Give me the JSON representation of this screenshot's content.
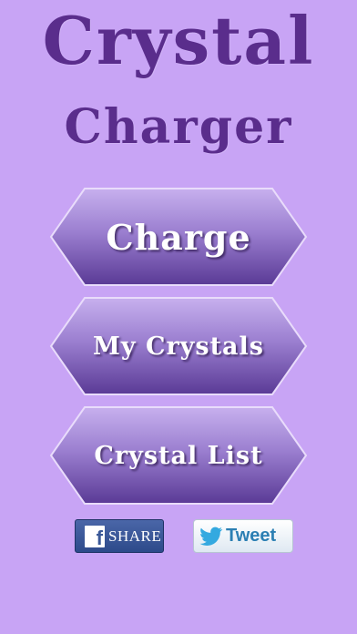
{
  "title": {
    "line1": "Crystal",
    "line2": "Charger"
  },
  "menu": {
    "charge_label": "Charge",
    "my_crystals_label": "My Crystals",
    "crystal_list_label": "Crystal List"
  },
  "social": {
    "share_label": "SHARE",
    "facebook_glyph": "f",
    "tweet_label": "Tweet"
  },
  "icons": {
    "facebook": "facebook-icon",
    "twitter": "twitter-bird-icon"
  },
  "colors": {
    "background": "#c8a4f5",
    "title": "#5a2d8c",
    "button_top": "#bca2e8",
    "button_bottom": "#5e3e9c",
    "facebook_blue": "#3b5998",
    "twitter_blue": "#2b7fb3"
  }
}
